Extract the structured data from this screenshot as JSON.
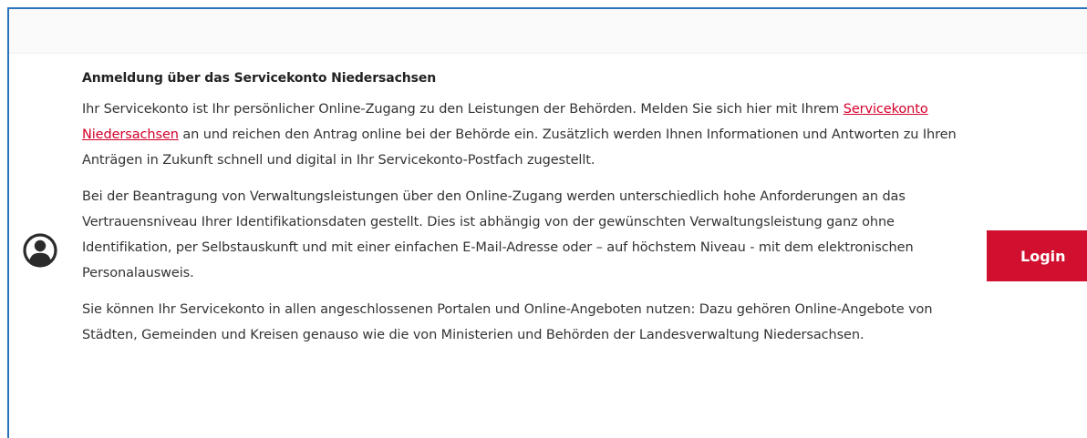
{
  "section": {
    "heading": "Anmeldung über das Servicekonto Niedersachsen",
    "intro": {
      "before_link": "Ihr Servicekonto ist Ihr persönlicher Online-Zugang zu den Leistungen der Behörden. Melden Sie sich hier mit Ihrem ",
      "link_text": "Servicekonto Niedersachsen",
      "after_link": " an und reichen den Antrag online bei der Behörde ein. Zusätzlich werden Ihnen Informationen und Antworten zu Ihren Anträgen in Zukunft schnell und digital in Ihr Servicekonto-Postfach zugestellt."
    },
    "paragraph_2": "Bei der Beantragung von Verwaltungsleistungen über den Online-Zugang werden unterschiedlich hohe Anforderungen an das Vertrauensniveau Ihrer Identifikationsdaten gestellt. Dies ist abhängig von der gewünschten Verwaltungsleistung ganz ohne Identifikation, per Selbstauskunft und mit einer einfachen E-Mail-Adresse oder – auf höchstem Niveau - mit dem elektronischen Personalausweis.",
    "paragraph_3": "Sie können Ihr Servicekonto in allen angeschlossenen Portalen und Online-Angeboten nutzen: Dazu gehören Online-Angebote von Städten, Gemeinden und Kreisen genauso wie die von Ministerien und Behörden der Landesverwaltung Niedersachsen."
  },
  "login_button": {
    "label": "Login"
  },
  "icons": {
    "avatar": "user-circle-icon"
  },
  "colors": {
    "accent": "#d0102e",
    "link": "#d4002a",
    "frame_border": "#2a73b8"
  }
}
